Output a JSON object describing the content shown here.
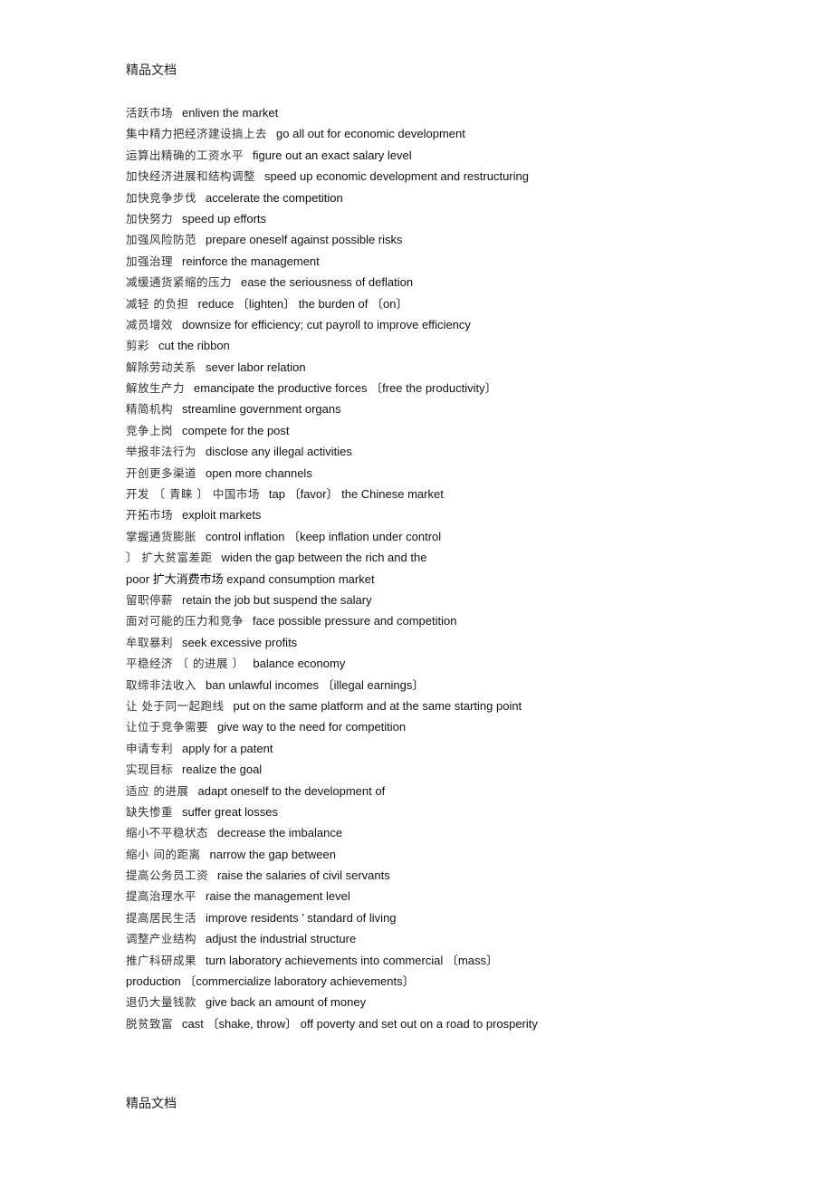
{
  "header": "精品文档",
  "footer": "精品文档",
  "entries": [
    [
      "活跃市场",
      "enliven the market"
    ],
    [
      "集中精力把经济建设搞上去",
      "go all out for economic development"
    ],
    [
      "运算出精确的工资水平",
      "figure out an exact salary level"
    ],
    [
      "加快经济进展和结构调整",
      "speed up economic development and restructuring"
    ],
    [
      "加快竞争步伐",
      "accelerate the competition"
    ],
    [
      "加快努力",
      "speed up efforts"
    ],
    [
      "加强风险防范",
      "prepare oneself against possible risks"
    ],
    [
      "加强治理",
      "reinforce the management"
    ],
    [
      "减缓通货紧缩的压力",
      "ease the seriousness of deflation"
    ],
    [
      "减轻  的负担",
      "reduce 〔lighten〕 the burden of 〔on〕"
    ],
    [
      "减员增效",
      "downsize for efficiency; cut payroll to improve efficiency"
    ],
    [
      "剪彩",
      "cut the ribbon"
    ],
    [
      "解除劳动关系",
      "sever labor relation"
    ],
    [
      "解放生产力",
      "emancipate the productive forces 〔free the productivity〕"
    ],
    [
      "精简机构",
      "streamline government organs"
    ],
    [
      "竞争上岗",
      "compete for the post"
    ],
    [
      "举报非法行为",
      "disclose any illegal activities"
    ],
    [
      "开创更多渠道",
      "open more channels"
    ],
    [
      "开发 〔 青睐 〕 中国市场",
      "tap 〔favor〕 the Chinese market"
    ],
    [
      "开拓市场",
      "exploit markets"
    ],
    [
      "掌握通货膨胀",
      "control inflation 〔keep inflation under control"
    ],
    [
      "〕 扩大贫富差距",
      "widen the gap between the rich and the"
    ],
    [
      "",
      "poor 扩大消费市场   expand consumption market"
    ],
    [
      "留职停薪",
      "retain the job but suspend the salary"
    ],
    [
      "面对可能的压力和竞争",
      "face possible pressure and competition"
    ],
    [
      "牟取暴利",
      "seek excessive profits"
    ],
    [
      "平稳经济 〔 的进展 〕",
      "balance economy"
    ],
    [
      "取缔非法收入",
      "ban unlawful incomes 〔illegal earnings〕"
    ],
    [
      "让  处于同一起跑线",
      "put      on the same platform and at the same starting point"
    ],
    [
      "让位于竞争需要",
      "give way to the need for competition"
    ],
    [
      "申请专利",
      "apply for a patent"
    ],
    [
      "实现目标",
      "realize the goal"
    ],
    [
      "适应  的进展",
      "adapt oneself to the development of"
    ],
    [
      "缺失惨重",
      "suffer great losses"
    ],
    [
      "缩小不平稳状态",
      "decrease the imbalance"
    ],
    [
      "缩小  间的距离",
      "narrow the gap between"
    ],
    [
      "提高公务员工资",
      "raise the salaries of civil servants"
    ],
    [
      "提高治理水平",
      "raise the management level"
    ],
    [
      "提高居民生活",
      "improve residents      ’   standard of living"
    ],
    [
      "调整产业结构",
      "adjust the industrial structure"
    ],
    [
      "推广科研成果",
      "turn laboratory achievements into commercial 〔mass〕"
    ],
    [
      "",
      "production 〔commercialize laboratory achievements〕"
    ],
    [
      "退仍大量钱款",
      "give back an amount of money"
    ],
    [
      "脱贫致富",
      "cast 〔shake, throw〕 off poverty and set out on a road to prosperity"
    ]
  ]
}
